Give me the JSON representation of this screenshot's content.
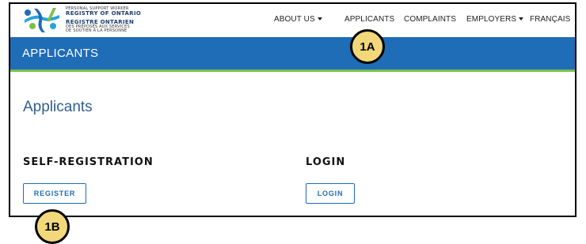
{
  "logo": {
    "line1": "PERSONAL SUPPORT WORKER",
    "line2": "REGISTRY OF ONTARIO",
    "line3": "REGISTRE ONTARIEN",
    "line4": "DES PRÉPOSÉS AUX SERVICES",
    "line5": "DE SOUTIEN À LA PERSONNE"
  },
  "nav": {
    "about_us": "ABOUT US",
    "applicants": "APPLICANTS",
    "complaints": "COMPLAINTS",
    "employers": "EMPLOYERS",
    "francais": "FRANÇAIS"
  },
  "banner": {
    "title": "APPLICANTS"
  },
  "page": {
    "title": "Applicants"
  },
  "self_registration": {
    "heading": "SELF-REGISTRATION",
    "button": "REGISTER"
  },
  "login": {
    "heading": "LOGIN",
    "button": "LOGIN"
  },
  "annotations": {
    "badge_a": "1A",
    "badge_b": "1B"
  },
  "colors": {
    "brand_blue": "#1f6cb7",
    "accent_green": "#7bbf4a",
    "badge_fill": "#f2d87a"
  }
}
